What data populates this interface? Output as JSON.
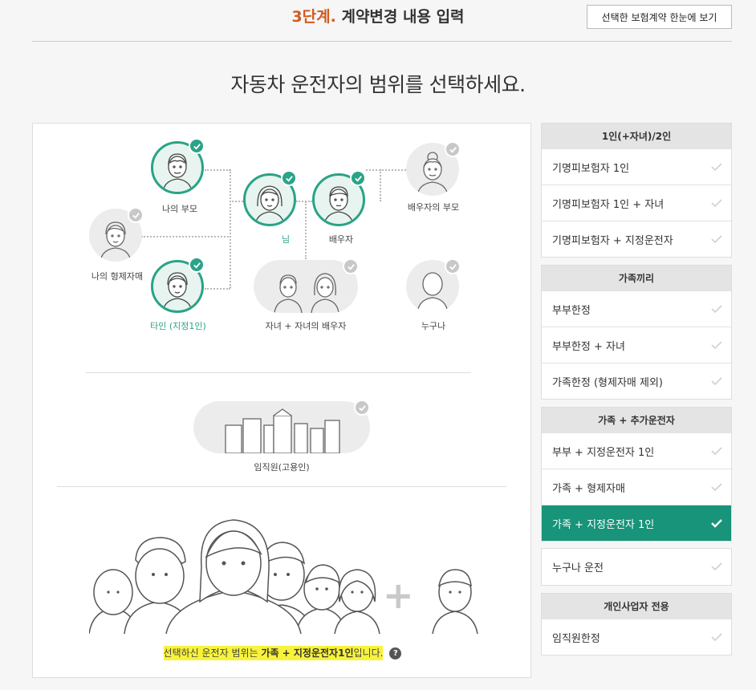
{
  "header": {
    "step": "3단계.",
    "title": "계약변경 내용 입력",
    "view_button": "선택한 보험계약 한눈에 보기"
  },
  "question": "자동차 운전자의 범위를 선택하세요.",
  "diagram": {
    "nodes": {
      "my_parents": {
        "label": "나의 부모",
        "selected": true
      },
      "me": {
        "label": "님",
        "selected": true
      },
      "spouse": {
        "label": "배우자",
        "selected": true
      },
      "spouse_parents": {
        "label": "배우자의 부모",
        "selected": false
      },
      "my_siblings": {
        "label": "나의 형제자매",
        "selected": false
      },
      "other_person": {
        "label": "타인 (지정1인)",
        "selected": true
      },
      "children": {
        "label": "자녀 + 자녀의 배우자",
        "selected": false
      },
      "anyone": {
        "label": "누구나",
        "selected": false
      },
      "employees": {
        "label": "임직원(고용인)",
        "selected": false
      }
    },
    "plus_sign": "+",
    "summary": {
      "prefix": "선택하신 운전자 범위는 ",
      "value": "가족 + 지정운전자1인",
      "suffix": "입니다.",
      "help": "?"
    }
  },
  "panels": [
    {
      "title": "1인(+자녀)/2인",
      "options": [
        {
          "label": "기명피보험자 1인",
          "selected": false
        },
        {
          "label": "기명피보험자 1인 + 자녀",
          "selected": false
        },
        {
          "label": "기명피보험자 + 지정운전자",
          "selected": false
        }
      ]
    },
    {
      "title": "가족끼리",
      "options": [
        {
          "label": "부부한정",
          "selected": false
        },
        {
          "label": "부부한정 + 자녀",
          "selected": false
        },
        {
          "label": "가족한정 (형제자매 제외)",
          "selected": false
        }
      ]
    },
    {
      "title": "가족 + 추가운전자",
      "options": [
        {
          "label": "부부 + 지정운전자 1인",
          "selected": false
        },
        {
          "label": "가족 + 형제자매",
          "selected": false
        },
        {
          "label": "가족 + 지정운전자 1인",
          "selected": true
        }
      ]
    },
    {
      "title": "",
      "options": [
        {
          "label": "누구나 운전",
          "selected": false
        }
      ]
    },
    {
      "title": "개인사업자 전용",
      "options": [
        {
          "label": "임직원한정",
          "selected": false
        }
      ]
    }
  ],
  "colors": {
    "accent": "#2aa387",
    "active_option": "#179479",
    "step_orange": "#d35a1e",
    "highlight": "#f8f33a",
    "unselected": "#c8c8c8"
  }
}
